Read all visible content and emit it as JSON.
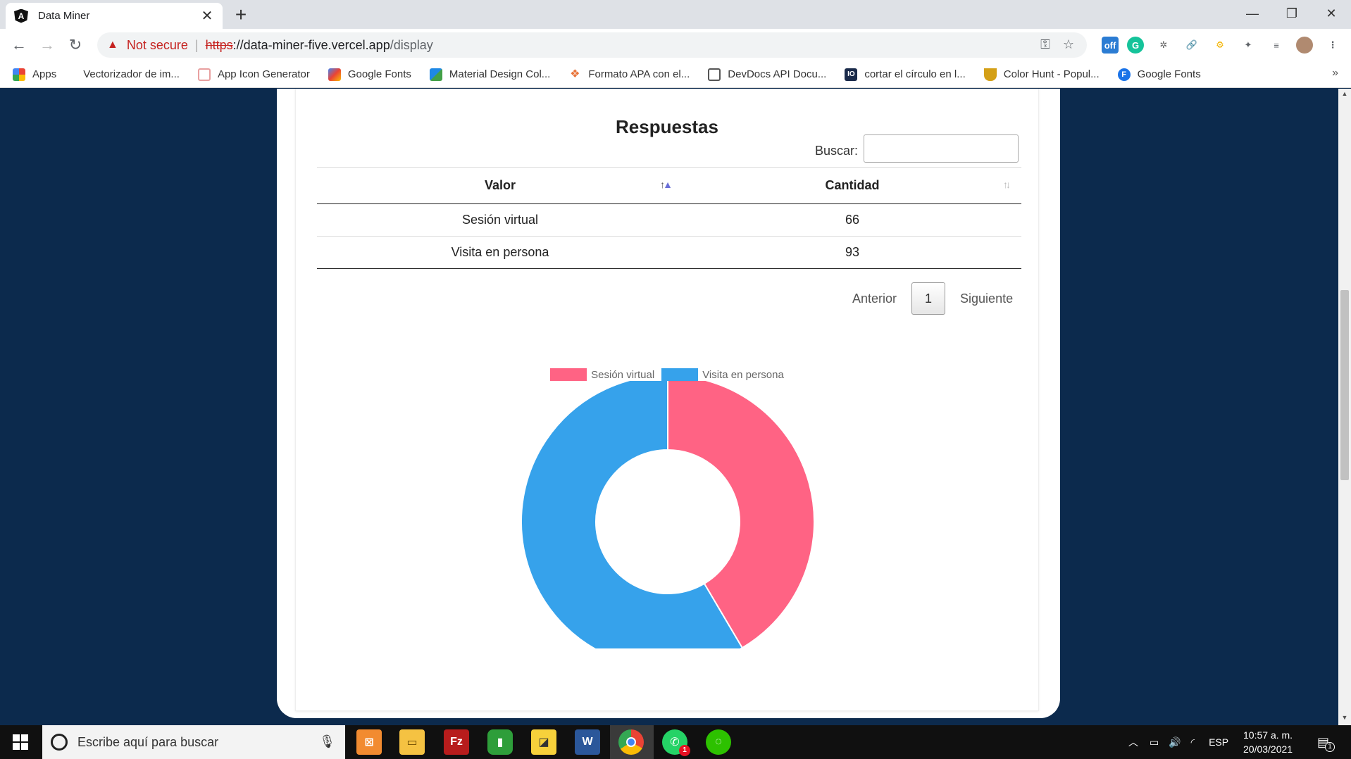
{
  "browser": {
    "tab_title": "Data Miner",
    "address": {
      "security": "Not secure",
      "scheme": "https",
      "host": "://data-miner-five.vercel.app",
      "path": "/display"
    },
    "bookmarks": [
      {
        "label": "Apps",
        "icon": "apps-grid-icon",
        "color": "#ea4335"
      },
      {
        "label": "Vectorizador de im...",
        "icon": "",
        "color": ""
      },
      {
        "label": "App Icon Generator",
        "icon": "app-icon-generator-icon",
        "color": "#e8a0a0"
      },
      {
        "label": "Google Fonts",
        "icon": "google-fonts-icon",
        "color": "#4285f4"
      },
      {
        "label": "Material Design Col...",
        "icon": "material-design-icon",
        "color": "#1e88e5"
      },
      {
        "label": "Formato APA con el...",
        "icon": "apa-icon",
        "color": "#e8743b"
      },
      {
        "label": "DevDocs API Docu...",
        "icon": "devdocs-icon",
        "color": "#555555"
      },
      {
        "label": "cortar el círculo en l...",
        "icon": "io-icon",
        "color": "#1a2a4a"
      },
      {
        "label": "Color Hunt - Popul...",
        "icon": "color-hunt-icon",
        "color": "#d4a017"
      },
      {
        "label": "Google Fonts",
        "icon": "google-fonts-f-icon",
        "color": "#1a73e8"
      }
    ]
  },
  "page": {
    "section_title": "Respuestas",
    "search": {
      "label": "Buscar:",
      "value": ""
    },
    "table": {
      "headers": [
        "Valor",
        "Cantidad"
      ],
      "rows": [
        [
          "Sesión virtual",
          "66"
        ],
        [
          "Visita en persona",
          "93"
        ]
      ]
    },
    "pagination": {
      "prev": "Anterior",
      "current": "1",
      "next": "Siguiente"
    }
  },
  "chart_data": {
    "type": "pie",
    "variant": "doughnut",
    "categories": [
      "Sesión virtual",
      "Visita en persona"
    ],
    "values": [
      66,
      93
    ],
    "colors": [
      "#ff6384",
      "#36a2eb"
    ],
    "legend": "top"
  },
  "taskbar": {
    "search_placeholder": "Escribe aquí para buscar",
    "language": "ESP",
    "time": "10:57 a. m.",
    "date": "20/03/2021",
    "notification_count": "1",
    "whatsapp_badge": "1"
  }
}
